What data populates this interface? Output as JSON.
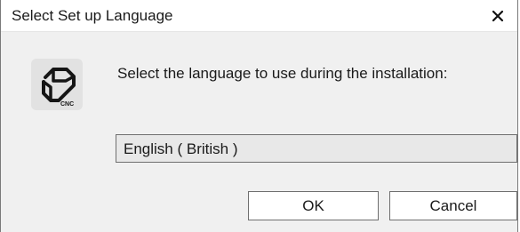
{
  "window": {
    "title": "Select Set up Language",
    "close_icon": "close-icon"
  },
  "app_icon": {
    "icon": "cnc-logo-icon",
    "badge_text": "CNC"
  },
  "prompt": "Select the language to use during the installation:",
  "language_select": {
    "selected": "English ( British )"
  },
  "buttons": {
    "ok_label": "OK",
    "cancel_label": "Cancel"
  }
}
